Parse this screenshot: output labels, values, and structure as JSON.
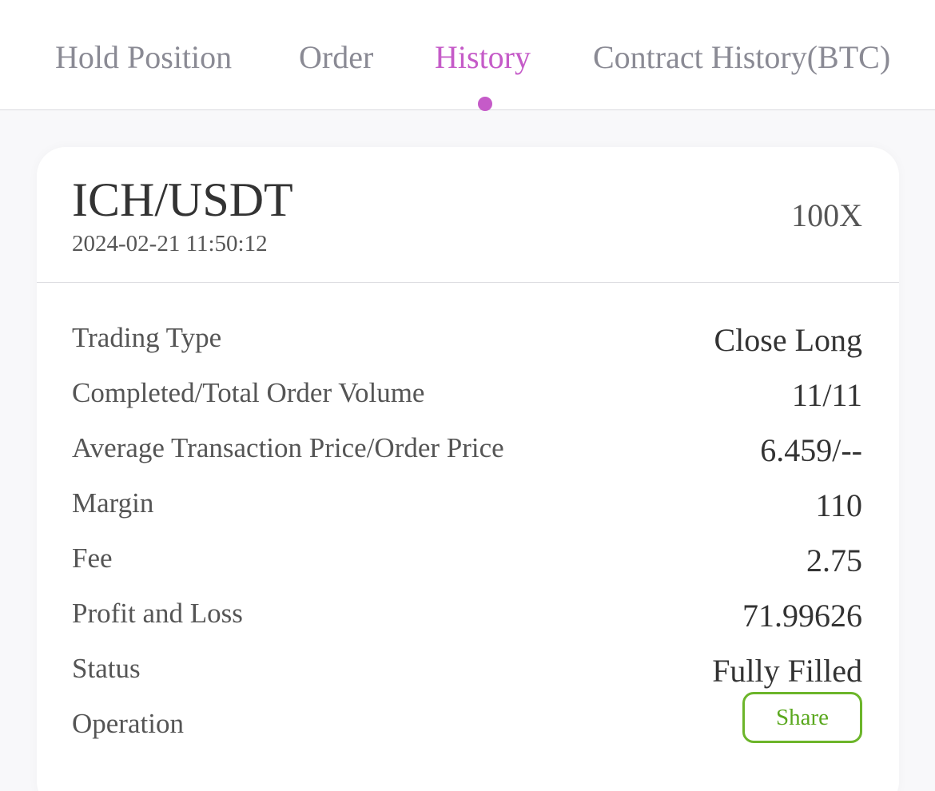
{
  "tabs": [
    {
      "label": "Hold Position",
      "active": false
    },
    {
      "label": "Order",
      "active": false
    },
    {
      "label": "History",
      "active": true
    },
    {
      "label": "Contract History(BTC)",
      "active": false
    }
  ],
  "colors": {
    "accent": "#c55bc8",
    "share_green": "#6cb52a",
    "text_dark": "#333333",
    "text_muted": "#8a8a94"
  },
  "card": {
    "pair": "ICH/USDT",
    "datetime": "2024-02-21 11:50:12",
    "leverage": "100X",
    "rows": [
      {
        "label": "Trading Type",
        "value": "Close Long"
      },
      {
        "label": "Completed/Total Order Volume",
        "value": "11/11"
      },
      {
        "label": "Average Transaction Price/Order Price",
        "value": "6.459/--"
      },
      {
        "label": "Margin",
        "value": "110"
      },
      {
        "label": "Fee",
        "value": "2.75"
      },
      {
        "label": "Profit and Loss",
        "value": "71.99626"
      },
      {
        "label": "Status",
        "value": "Fully Filled"
      }
    ],
    "operation_label": "Operation",
    "share_label": "Share"
  }
}
